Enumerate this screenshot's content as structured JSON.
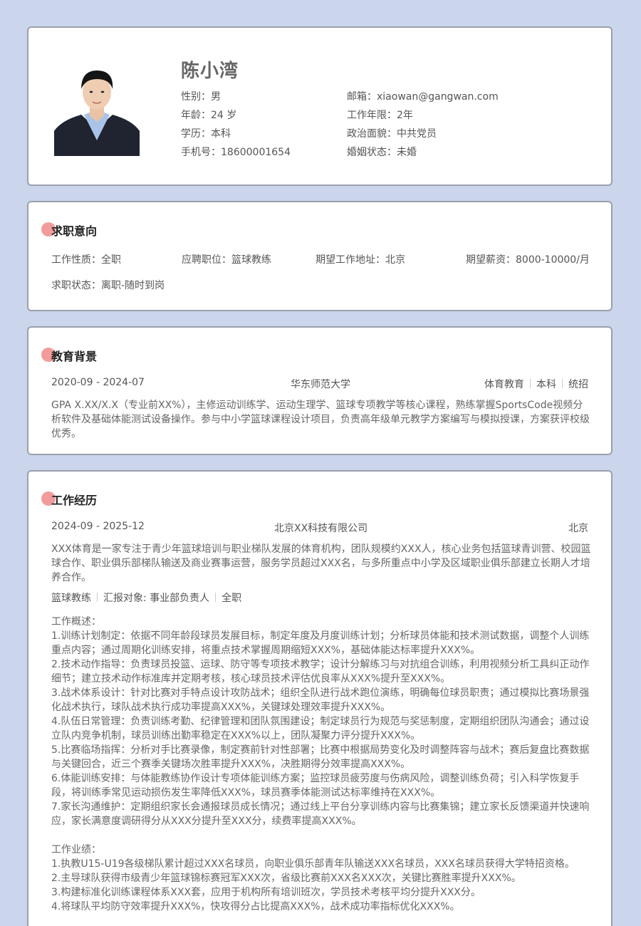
{
  "profile": {
    "name": "陈小湾",
    "left": [
      {
        "label": "性别：",
        "value": "男"
      },
      {
        "label": "年龄：",
        "value": "24 岁"
      },
      {
        "label": "学历：",
        "value": "本科"
      },
      {
        "label": "手机号：",
        "value": "18600001654"
      }
    ],
    "right": [
      {
        "label": "邮箱：",
        "value": "xiaowan@gangwan.com"
      },
      {
        "label": "工作年限：",
        "value": "2年"
      },
      {
        "label": "政治面貌：",
        "value": "中共党员"
      },
      {
        "label": "婚姻状态：",
        "value": "未婚"
      }
    ]
  },
  "intent": {
    "title": "求职意向",
    "items": [
      {
        "label": "工作性质：",
        "value": "全职"
      },
      {
        "label": "应聘职位：",
        "value": "篮球教练"
      },
      {
        "label": "期望工作地址：",
        "value": "北京"
      },
      {
        "label": "期望薪资：",
        "value": "8000-10000/月"
      },
      {
        "label": "求职状态：",
        "value": "离职-随时到岗"
      }
    ]
  },
  "education": {
    "title": "教育背景",
    "period": "2020-09 - 2024-07",
    "school": "华东师范大学",
    "major": "体育教育",
    "degree": "本科",
    "type": "统招",
    "desc": "GPA X.XX/X.X（专业前XX%），主修运动训练学、运动生理学、篮球专项教学等核心课程，熟练掌握SportsCode视频分析软件及基础体能测试设备操作。参与中小学篮球课程设计项目，负责高年级单元教学方案编写与模拟授课，方案获评校级优秀。"
  },
  "work": {
    "title": "工作经历",
    "period": "2024-09 - 2025-12",
    "company": "北京XX科技有限公司",
    "city": "北京",
    "company_desc": "XXX体育是一家专注于青少年篮球培训与职业梯队发展的体育机构，团队规模约XXX人，核心业务包括篮球青训营、校园篮球合作、职业俱乐部梯队输送及商业赛事运营，服务学员超过XXX名，与多所重点中小学及区域职业俱乐部建立长期人才培养合作。",
    "role": "篮球教练",
    "report_to": "汇报对象: 事业部负责人",
    "job_type": "全职",
    "overview_title": "工作概述：",
    "overview": [
      "1.训练计划制定：依据不同年龄段球员发展目标，制定年度及月度训练计划；分析球员体能和技术测试数据，调整个人训练重点内容；通过周期化训练安排，将重点技术掌握周期缩短XXX%，基础体能达标率提升XXX%。",
      "2.技术动作指导：负责球员投篮、运球、防守等专项技术教学；设计分解练习与对抗组合训练，利用视频分析工具纠正动作细节；建立技术动作标准库并定期考核，核心球员技术评估优良率从XXX%提升至XXX%。",
      "3.战术体系设计：针对比赛对手特点设计攻防战术；组织全队进行战术跑位演练，明确每位球员职责；通过模拟比赛场景强化战术执行，球队战术执行成功率提高XXX%，关键球处理效率提升XXX%。",
      "4.队伍日常管理：负责训练考勤、纪律管理和团队氛围建设；制定球员行为规范与奖惩制度，定期组织团队沟通会；通过设立队内竞争机制，球员训练出勤率稳定在XXX%以上，团队凝聚力评分提升XXX%。",
      "5.比赛临场指挥：分析对手比赛录像，制定赛前针对性部署；比赛中根据局势变化及时调整阵容与战术；赛后复盘比赛数据与关键回合，近三个赛季关键场次胜率提升XXX%，决胜期得分效率提高XXX%。",
      "6.体能训练安排：与体能教练协作设计专项体能训练方案；监控球员疲劳度与伤病风险，调整训练负荷；引入科学恢复手段，将训练季常见运动损伤发生率降低XXX%，球员赛季体能测试达标率维持在XXX%。",
      "7.家长沟通维护：定期组织家长会通报球员成长情况；通过线上平台分享训练内容与比赛集锦；建立家长反馈渠道并快速响应，家长满意度调研得分从XXX分提升至XXX分，续费率提高XXX%。"
    ],
    "achievements_title": "工作业绩：",
    "achievements": [
      "1.执教U15-U19各级梯队累计超过XXX名球员，向职业俱乐部青年队输送XXX名球员，XXX名球员获得大学特招资格。",
      "2.主导球队获得市级青少年篮球锦标赛冠军XXX次，省级比赛前XXX名XXX次，关键比赛胜率提升XXX%。",
      "3.构建标准化训练课程体系XXX套，应用于机构所有培训班次，学员技术考核平均分提升XXX分。",
      "4.将球队平均防守效率提升XXX%，快攻得分占比提高XXX%，战术成功率指标优化XXX%。"
    ]
  }
}
